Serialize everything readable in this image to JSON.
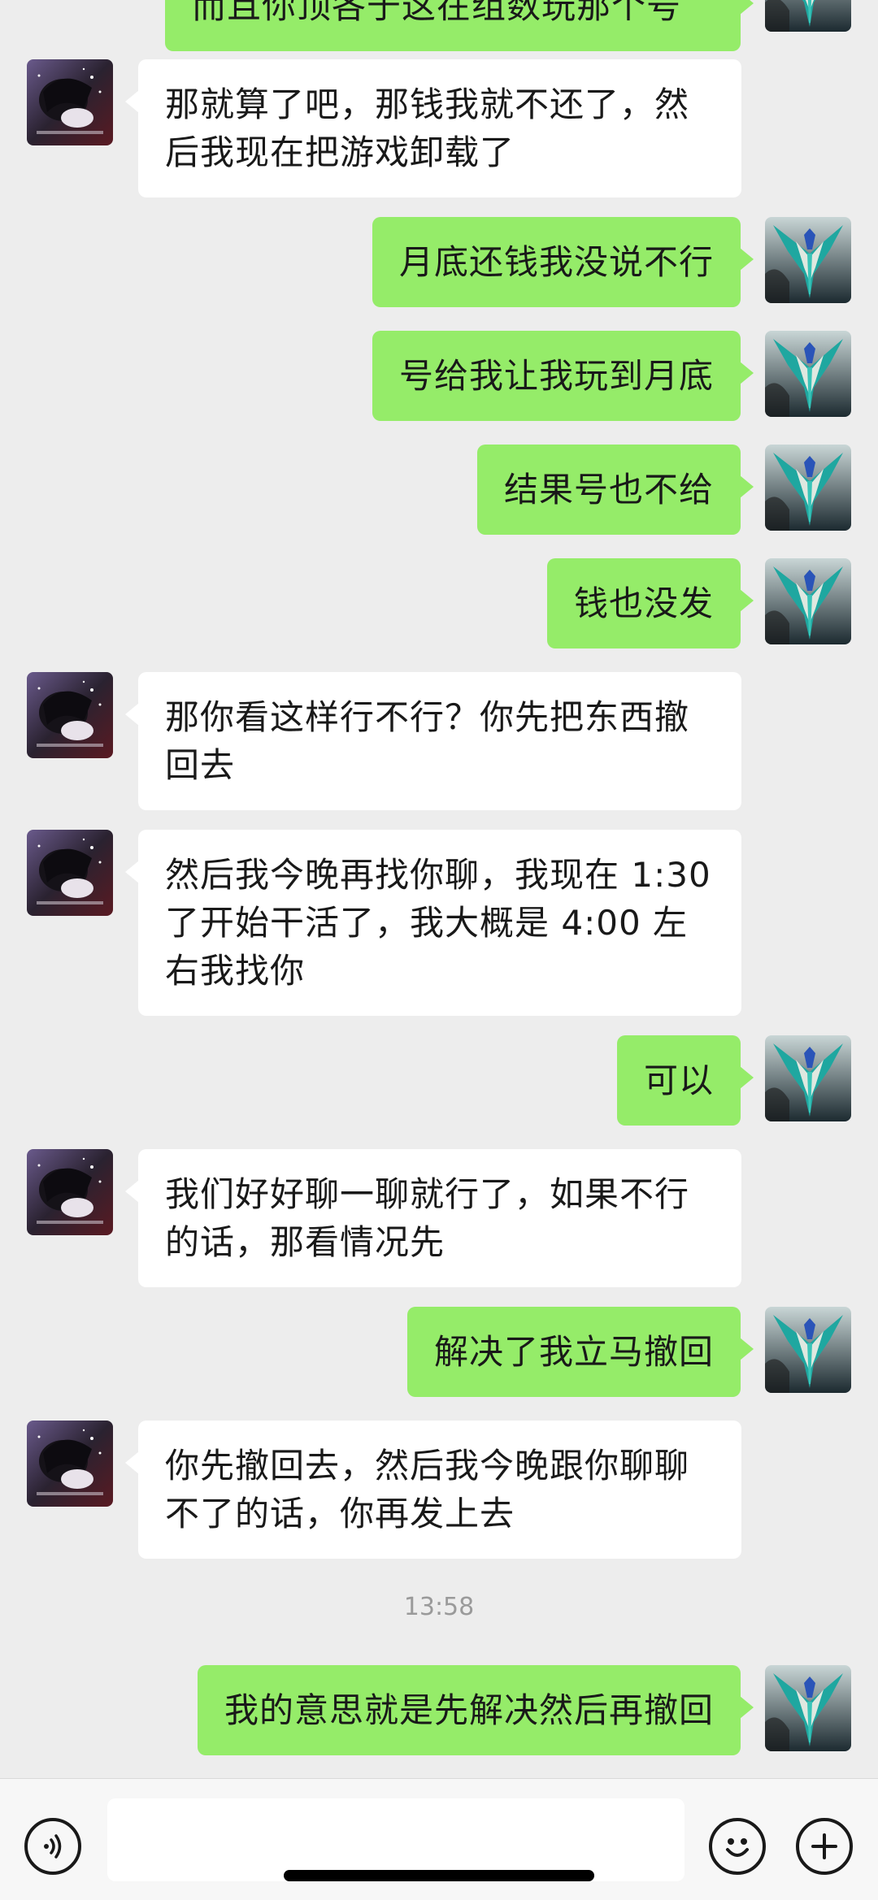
{
  "chat": {
    "messages": [
      {
        "side": "right",
        "text": "而且你顶各于这在组数玩那个号"
      },
      {
        "side": "left",
        "text": "那就算了吧，那钱我就不还了，然后我现在把游戏卸载了"
      },
      {
        "side": "right",
        "text": "月底还钱我没说不行"
      },
      {
        "side": "right",
        "text": "号给我让我玩到月底"
      },
      {
        "side": "right",
        "text": "结果号也不给"
      },
      {
        "side": "right",
        "text": "钱也没发"
      },
      {
        "side": "left",
        "text": "那你看这样行不行？你先把东西撤回去"
      },
      {
        "side": "left",
        "text": "然后我今晚再找你聊，我现在 1:30 了开始干活了，我大概是 4:00 左右我找你"
      },
      {
        "side": "right",
        "text": "可以"
      },
      {
        "side": "left",
        "text": "我们好好聊一聊就行了，如果不行的话，那看情况先"
      },
      {
        "side": "right",
        "text": "解决了我立马撤回"
      },
      {
        "side": "left",
        "text": "你先撤回去，然后我今晚跟你聊聊不了的话，你再发上去"
      },
      {
        "side": "right",
        "text": "我的意思就是先解决然后再撤回"
      }
    ],
    "timestamp": "13:58"
  },
  "input_bar": {
    "voice_icon": "voice-icon",
    "emoji_icon": "emoji-icon",
    "more_icon": "plus-icon",
    "text_value": ""
  },
  "colors": {
    "background": "#ededed",
    "sent_bubble": "#95ec69",
    "received_bubble": "#ffffff"
  }
}
